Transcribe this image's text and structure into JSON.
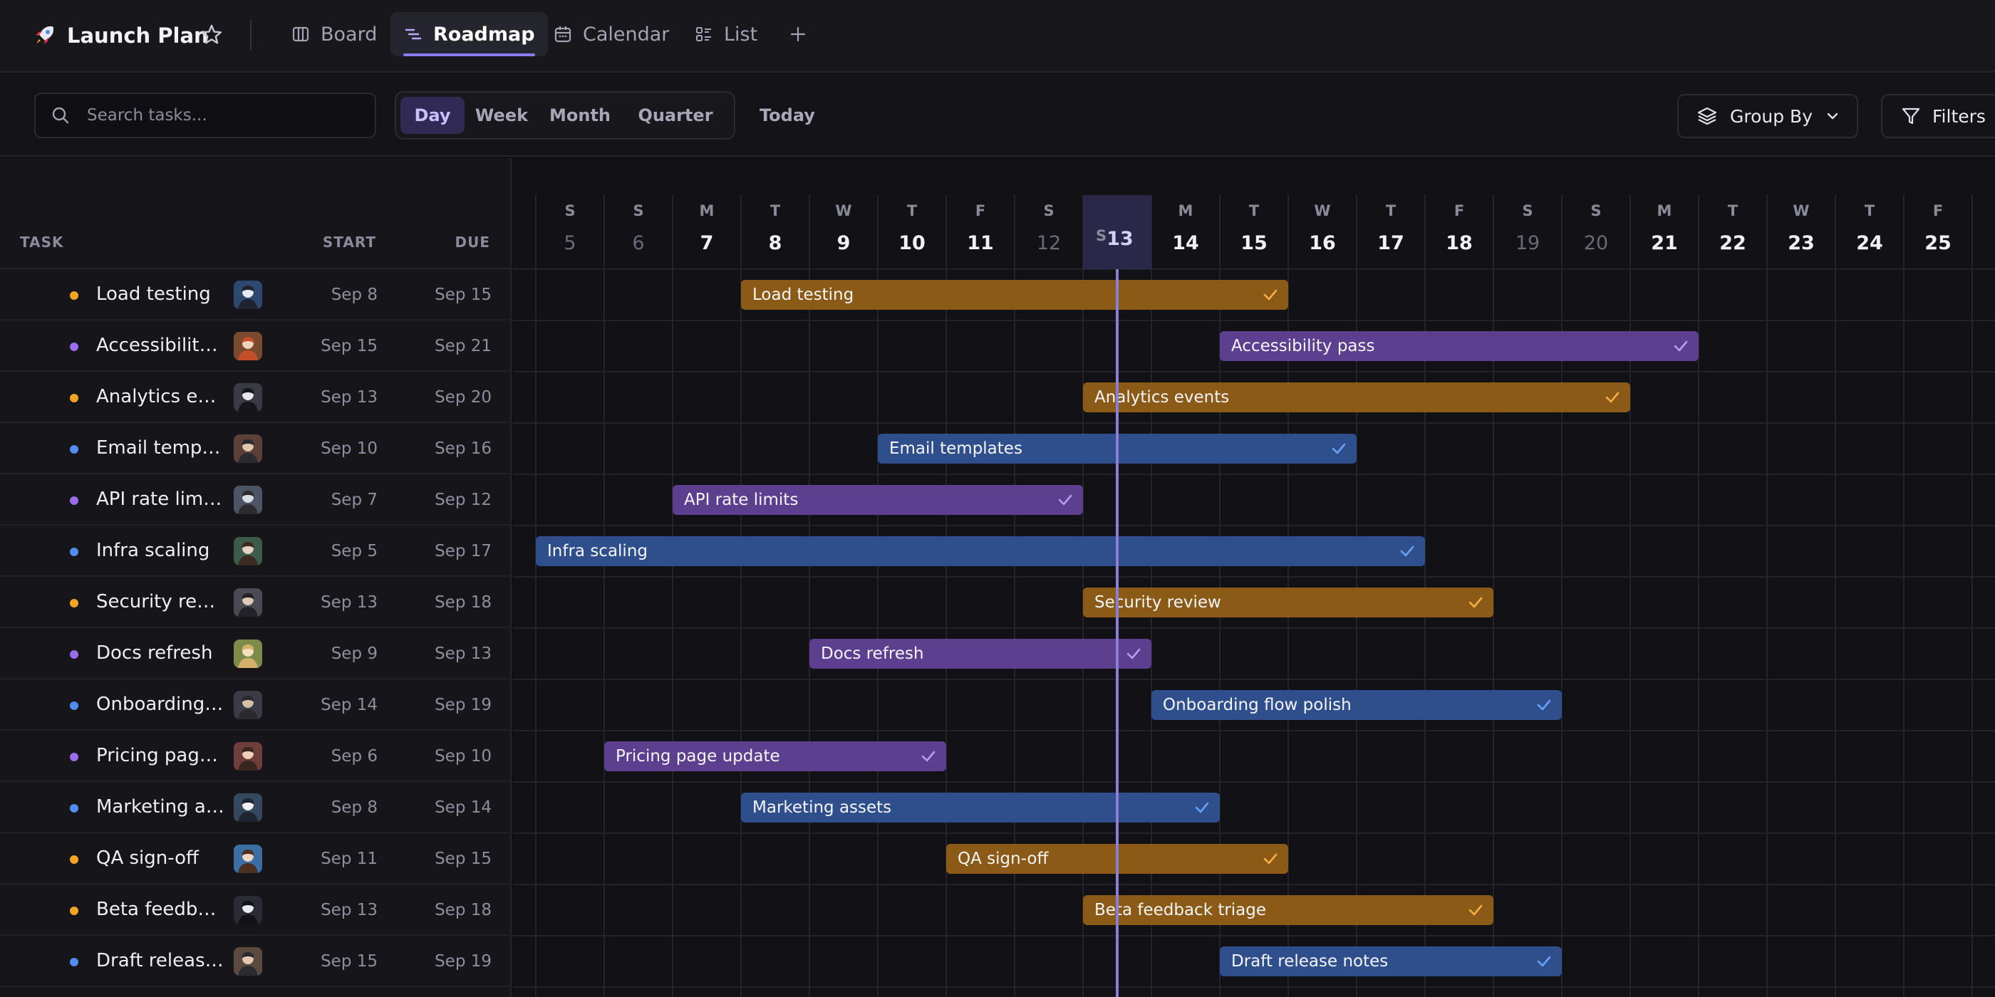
{
  "app": {
    "title": "Launch Plan",
    "tabs": [
      {
        "label": "Board",
        "icon": "board-icon"
      },
      {
        "label": "Roadmap",
        "icon": "roadmap-icon"
      },
      {
        "label": "Calendar",
        "icon": "calendar-icon"
      },
      {
        "label": "List",
        "icon": "list-icon"
      }
    ],
    "active_tab": "Roadmap"
  },
  "toolbar": {
    "search_placeholder": "Search tasks...",
    "views": [
      "Day",
      "Week",
      "Month",
      "Quarter"
    ],
    "active_view": "Day",
    "today_label": "Today",
    "group_by_label": "Group By",
    "filters_label": "Filters"
  },
  "table": {
    "headers": {
      "task": "TASK",
      "start": "START",
      "due": "DUE"
    },
    "rows": [
      {
        "name": "Load testing",
        "start": "Sep 8",
        "due": "Sep 15",
        "color": "#f5a524"
      },
      {
        "name": "Accessibility pass",
        "start": "Sep 15",
        "due": "Sep 21",
        "color": "#9b6cf0"
      },
      {
        "name": "Analytics events",
        "start": "Sep 13",
        "due": "Sep 20",
        "color": "#f5a524"
      },
      {
        "name": "Email templates",
        "start": "Sep 10",
        "due": "Sep 16",
        "color": "#4d8ef0"
      },
      {
        "name": "API rate limits",
        "start": "Sep 7",
        "due": "Sep 12",
        "color": "#9b6cf0"
      },
      {
        "name": "Infra scaling",
        "start": "Sep 5",
        "due": "Sep 17",
        "color": "#4d8ef0"
      },
      {
        "name": "Security review",
        "start": "Sep 13",
        "due": "Sep 18",
        "color": "#f5a524"
      },
      {
        "name": "Docs refresh",
        "start": "Sep 9",
        "due": "Sep 13",
        "color": "#9b6cf0"
      },
      {
        "name": "Onboarding flow polish",
        "start": "Sep 14",
        "due": "Sep 19",
        "color": "#4d8ef0"
      },
      {
        "name": "Pricing page update",
        "start": "Sep 6",
        "due": "Sep 10",
        "color": "#9b6cf0"
      },
      {
        "name": "Marketing assets",
        "start": "Sep 8",
        "due": "Sep 14",
        "color": "#4d8ef0"
      },
      {
        "name": "QA sign-off",
        "start": "Sep 11",
        "due": "Sep 15",
        "color": "#f5a524"
      },
      {
        "name": "Beta feedback triage",
        "start": "Sep 13",
        "due": "Sep 18",
        "color": "#f5a524"
      },
      {
        "name": "Draft release notes",
        "start": "Sep 15",
        "due": "Sep 19",
        "color": "#4d8ef0"
      }
    ]
  },
  "timeline": {
    "days": [
      {
        "w": "S",
        "d": 5,
        "weekend": true
      },
      {
        "w": "S",
        "d": 6,
        "weekend": true
      },
      {
        "w": "M",
        "d": 7
      },
      {
        "w": "T",
        "d": 8
      },
      {
        "w": "W",
        "d": 9
      },
      {
        "w": "T",
        "d": 10
      },
      {
        "w": "F",
        "d": 11
      },
      {
        "w": "S",
        "d": 12,
        "weekend": true
      },
      {
        "w": "S",
        "d": 13,
        "today": true
      },
      {
        "w": "M",
        "d": 14
      },
      {
        "w": "T",
        "d": 15
      },
      {
        "w": "W",
        "d": 16
      },
      {
        "w": "T",
        "d": 17
      },
      {
        "w": "F",
        "d": 18
      },
      {
        "w": "S",
        "d": 19,
        "weekend": true
      },
      {
        "w": "S",
        "d": 20,
        "weekend": true
      },
      {
        "w": "M",
        "d": 21
      },
      {
        "w": "T",
        "d": 22
      },
      {
        "w": "W",
        "d": 23
      },
      {
        "w": "T",
        "d": 24
      },
      {
        "w": "F",
        "d": 25
      }
    ],
    "today": 13,
    "bar_colors": {
      "amber": {
        "fill": "#8a5a16",
        "check": "#f5b041"
      },
      "purple": {
        "fill": "#5c3f8e",
        "check": "#b79cf5"
      },
      "blue": {
        "fill": "#2e4f8c",
        "check": "#6aa0f5"
      }
    },
    "bars": [
      {
        "label": "Load testing",
        "start": 8,
        "end": 15,
        "color": "amber"
      },
      {
        "label": "Accessibility pass",
        "start": 15,
        "end": 21,
        "color": "purple"
      },
      {
        "label": "Analytics events",
        "start": 13,
        "end": 20,
        "color": "amber"
      },
      {
        "label": "Email templates",
        "start": 10,
        "end": 16,
        "color": "blue"
      },
      {
        "label": "API rate limits",
        "start": 7,
        "end": 12,
        "color": "purple"
      },
      {
        "label": "Infra scaling",
        "start": 5,
        "end": 17,
        "color": "blue"
      },
      {
        "label": "Security review",
        "start": 13,
        "end": 18,
        "color": "amber"
      },
      {
        "label": "Docs refresh",
        "start": 9,
        "end": 13,
        "color": "purple"
      },
      {
        "label": "Onboarding flow polish",
        "start": 14,
        "end": 19,
        "color": "blue"
      },
      {
        "label": "Pricing page update",
        "start": 6,
        "end": 10,
        "color": "purple"
      },
      {
        "label": "Marketing assets",
        "start": 8,
        "end": 14,
        "color": "blue"
      },
      {
        "label": "QA sign-off",
        "start": 11,
        "end": 15,
        "color": "amber"
      },
      {
        "label": "Beta feedback triage",
        "start": 13,
        "end": 18,
        "color": "amber"
      },
      {
        "label": "Draft release notes",
        "start": 15,
        "end": 19,
        "color": "blue"
      }
    ]
  }
}
